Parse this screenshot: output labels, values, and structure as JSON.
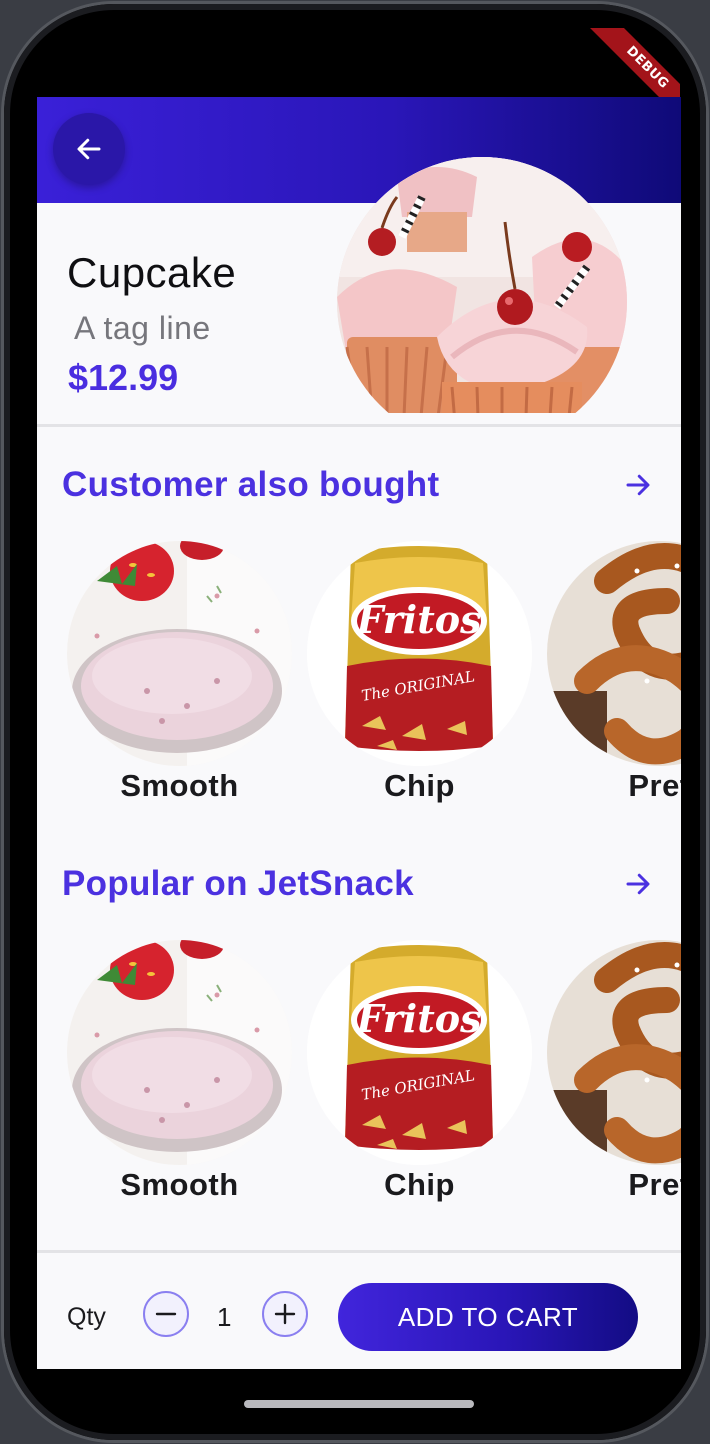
{
  "debug_banner": "DEBUG",
  "header": {
    "back_icon": "arrow-left-icon"
  },
  "product": {
    "name": "Cupcake",
    "tagline": "A tag line",
    "price": "$12.99",
    "image": "cupcake-photo"
  },
  "collections": [
    {
      "title": "Customer also bought",
      "arrow_icon": "arrow-right-icon",
      "items": [
        {
          "label": "Smooth",
          "image": "strawberry-smoothie-photo"
        },
        {
          "label": "Chip",
          "image": "fritos-bag-photo"
        },
        {
          "label": "Pret",
          "image": "pretzel-photo"
        }
      ]
    },
    {
      "title": "Popular on JetSnack",
      "arrow_icon": "arrow-right-icon",
      "items": [
        {
          "label": "Smooth",
          "image": "strawberry-smoothie-photo"
        },
        {
          "label": "Chip",
          "image": "fritos-bag-photo"
        },
        {
          "label": "Pret",
          "image": "pretzel-photo"
        }
      ]
    }
  ],
  "cart": {
    "qty_label": "Qty",
    "qty_value": "1",
    "minus_icon": "minus-circle-icon",
    "plus_icon": "plus-circle-icon",
    "add_button": "ADD TO CART"
  },
  "colors": {
    "brand": "#4b31e0",
    "header_gradient_start": "#3a20d8",
    "header_gradient_end": "#0f0a78",
    "debug": "#a3141a"
  }
}
